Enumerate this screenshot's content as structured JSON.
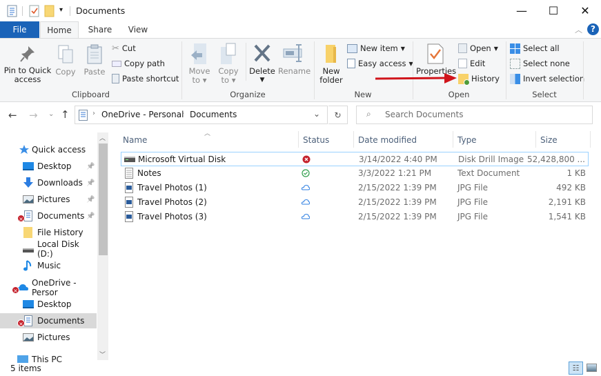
{
  "window": {
    "title": "Documents",
    "quick_access_toolbar": [
      "properties-icon",
      "new-folder-icon",
      "customize-dropdown-icon"
    ],
    "controls": {
      "minimize": "—",
      "maximize": "☐",
      "close": "✕"
    }
  },
  "ribbon_tabs": [
    {
      "label": "File",
      "active": false
    },
    {
      "label": "Home",
      "active": true
    },
    {
      "label": "Share",
      "active": false
    },
    {
      "label": "View",
      "active": false
    }
  ],
  "ribbon": {
    "clipboard": {
      "group_label": "Clipboard",
      "pin_label_1": "Pin to Quick",
      "pin_label_2": "access",
      "copy": "Copy",
      "paste": "Paste",
      "cut": "Cut",
      "copy_path": "Copy path",
      "paste_shortcut": "Paste shortcut"
    },
    "organize": {
      "group_label": "Organize",
      "move_to_1": "Move",
      "move_to_2": "to",
      "copy_to_1": "Copy",
      "copy_to_2": "to",
      "delete": "Delete",
      "rename": "Rename"
    },
    "new": {
      "group_label": "New",
      "new_folder_1": "New",
      "new_folder_2": "folder",
      "new_item": "New item",
      "easy_access": "Easy access"
    },
    "open": {
      "group_label": "Open",
      "properties": "Properties",
      "open": "Open",
      "edit": "Edit",
      "history": "History"
    },
    "select": {
      "group_label": "Select",
      "select_all": "Select all",
      "select_none": "Select none",
      "invert_selection": "Invert selection"
    }
  },
  "annotation": {
    "arrow_color": "#d0141b",
    "points_to": "History"
  },
  "address_bar": {
    "breadcrumb": [
      "OneDrive - Personal",
      "Documents"
    ],
    "search_placeholder": "Search Documents"
  },
  "sidebar": {
    "items": [
      {
        "label": "Quick access",
        "icon": "star-icon",
        "pinned": false
      },
      {
        "label": "Desktop",
        "icon": "desktop-icon",
        "pinned": true
      },
      {
        "label": "Downloads",
        "icon": "downloads-icon",
        "pinned": true
      },
      {
        "label": "Pictures",
        "icon": "pictures-icon",
        "pinned": true
      },
      {
        "label": "Documents",
        "icon": "documents-icon",
        "pinned": true,
        "error": true
      },
      {
        "label": "File History",
        "icon": "folder-icon",
        "pinned": false
      },
      {
        "label": "Local Disk (D:)",
        "icon": "drive-icon",
        "pinned": false
      },
      {
        "label": "Music",
        "icon": "music-icon",
        "pinned": false
      },
      {
        "label": "OneDrive - Persor",
        "icon": "onedrive-icon",
        "pinned": false,
        "error": true
      },
      {
        "label": "Desktop",
        "icon": "desktop-icon",
        "pinned": false
      },
      {
        "label": "Documents",
        "icon": "documents-icon",
        "pinned": false,
        "error": true,
        "selected": true
      },
      {
        "label": "Pictures",
        "icon": "pictures-icon",
        "pinned": false
      },
      {
        "label": "This PC",
        "icon": "pc-icon",
        "pinned": false
      }
    ]
  },
  "file_list": {
    "columns": [
      "Name",
      "Status",
      "Date modified",
      "Type",
      "Size"
    ],
    "rows": [
      {
        "name": "Microsoft Virtual Disk",
        "icon": "disk-image-icon",
        "status": "error",
        "date": "3/14/2022 4:40 PM",
        "type": "Disk Drill Image",
        "size": "52,428,800 ..."
      },
      {
        "name": "Notes",
        "icon": "text-file-icon",
        "status": "synced",
        "date": "3/3/2022 1:21 PM",
        "type": "Text Document",
        "size": "1 KB"
      },
      {
        "name": "Travel Photos (1)",
        "icon": "image-file-icon",
        "status": "cloud",
        "date": "2/15/2022 1:39 PM",
        "type": "JPG File",
        "size": "492 KB"
      },
      {
        "name": "Travel Photos (2)",
        "icon": "image-file-icon",
        "status": "cloud",
        "date": "2/15/2022 1:39 PM",
        "type": "JPG File",
        "size": "2,191 KB"
      },
      {
        "name": "Travel Photos (3)",
        "icon": "image-file-icon",
        "status": "cloud",
        "date": "2/15/2022 1:39 PM",
        "type": "JPG File",
        "size": "1,541 KB"
      }
    ]
  },
  "status_bar": {
    "item_count": "5 items",
    "view": "details"
  }
}
